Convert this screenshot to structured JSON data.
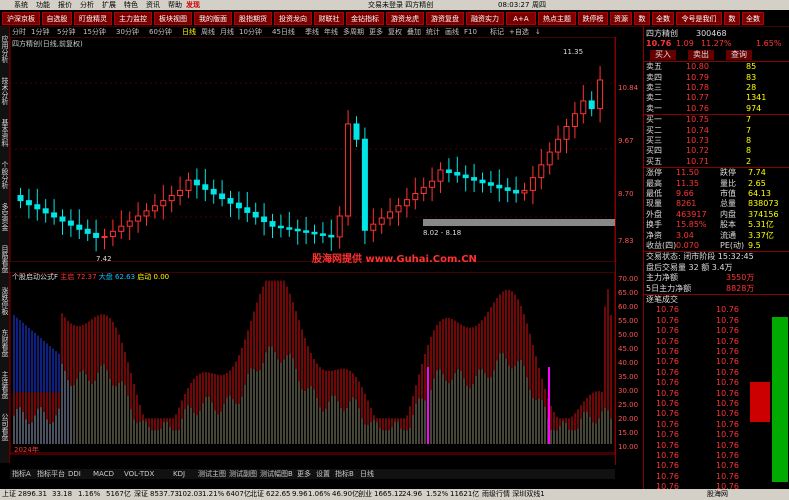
{
  "menu": {
    "items": [
      "系统",
      "功能",
      "报价",
      "分析",
      "扩展",
      "特色",
      "资讯",
      "帮助"
    ],
    "highlight": "发现",
    "center": "交易未登录 四方精创",
    "time": "08:03:27",
    "weekday": "周四"
  },
  "toolbar": [
    "沪深京板",
    "自选股",
    "盯盘精灵",
    "主力监控",
    "板块视图",
    "我的版面",
    "股指期货",
    "投资龙向",
    "财联社",
    "金钻指标",
    "游资龙虎",
    "游资复盘",
    "融资实力",
    "A+A",
    "热点主题",
    "跌停榜",
    "资源",
    "数",
    "全数",
    "令号是我们",
    "数",
    "全数"
  ],
  "period": [
    "分时",
    "1分钟",
    "5分钟",
    "15分钟",
    "30分钟",
    "60分钟",
    "日线",
    "周线",
    "月线",
    "10分钟",
    "45日线",
    "季线",
    "年线",
    "多周期",
    "更多",
    "复权",
    "叠加",
    "统计",
    "画线",
    "F10",
    "标记",
    "+自选",
    "↓"
  ],
  "left_tabs": [
    "应用分析",
    "技术分析",
    "基本资料",
    "个股分析",
    "多空资金",
    "目筋看盘",
    "涨跌停板",
    "东财看盘",
    "主连看盘",
    "公司看盘",
    "分时"
  ],
  "main_header": "四方精创(日线,前复权)",
  "main_ticks": [
    "10.84",
    "9.67",
    "8.70",
    "7.83"
  ],
  "sub_header": {
    "name": "个股启动公式F",
    "a_label": "主启",
    "a_val": "72.37",
    "b_label": "大盘",
    "b_val": "62.63",
    "c_label": "启动",
    "c_val": "0.00"
  },
  "sub_ticks": [
    "70.00",
    "65.00",
    "60.00",
    "55.00",
    "50.00",
    "45.00",
    "40.00",
    "35.00",
    "30.00",
    "25.00",
    "20.00",
    "15.00",
    "10.00"
  ],
  "annotations": {
    "high": "11.35",
    "low": "7.42",
    "range": "8.02 - 8.18",
    "year": "2024年",
    "marker1": "条",
    "marker2": "B1"
  },
  "watermark": "股海网提供 www.Guhai.Com.CN",
  "bottom_tabs": [
    "指标A",
    "指标平台",
    "DDI",
    "MACD",
    "VOL-TDX",
    "KDJ",
    "测试主图",
    "测试副图",
    "测试幅图B",
    "更多",
    "设置",
    "指标B",
    "日线"
  ],
  "stock": {
    "name": "四方精创",
    "code": "300468",
    "price": "10.76",
    "change": "1.09",
    "pct": "11.27%",
    "ratio": "1.65%",
    "btns": [
      "买入",
      "卖出",
      "查询"
    ]
  },
  "asks": [
    {
      "l": "卖五",
      "p": "10.80",
      "v": "85"
    },
    {
      "l": "卖四",
      "p": "10.79",
      "v": "83"
    },
    {
      "l": "卖三",
      "p": "10.78",
      "v": "28"
    },
    {
      "l": "卖二",
      "p": "10.77",
      "v": "1341"
    },
    {
      "l": "卖一",
      "p": "10.76",
      "v": "974"
    }
  ],
  "bids": [
    {
      "l": "买一",
      "p": "10.75",
      "v": "7"
    },
    {
      "l": "买二",
      "p": "10.74",
      "v": "7"
    },
    {
      "l": "买三",
      "p": "10.73",
      "v": "8"
    },
    {
      "l": "买四",
      "p": "10.72",
      "v": "8"
    },
    {
      "l": "买五",
      "p": "10.71",
      "v": "2"
    }
  ],
  "quote": [
    {
      "a": "涨停",
      "b": "11.50",
      "c": "跌停",
      "d": "7.74"
    },
    {
      "a": "最高",
      "b": "11.35",
      "c": "量比",
      "d": "2.65"
    },
    {
      "a": "最低",
      "b": "9.66",
      "c": "市值",
      "d": "64.13"
    },
    {
      "a": "现量",
      "b": "8261",
      "c": "总量",
      "d": "838073"
    },
    {
      "a": "外盘",
      "b": "463917",
      "c": "内盘",
      "d": "374156"
    },
    {
      "a": "换手",
      "b": "15.85%",
      "c": "股本",
      "d": "5.31亿"
    },
    {
      "a": "净资",
      "b": "3.04",
      "c": "流通",
      "d": "3.37亿"
    },
    {
      "a": "收益(四)",
      "b": "0.070",
      "c": "PE(动)",
      "d": "9.5"
    }
  ],
  "trade_status": {
    "line1": "交易状态: 闭市阶段 15:32:45",
    "line2": "盘后交易量 32 额 3.4万"
  },
  "flows": [
    {
      "l": "主力净额",
      "v": "3550万"
    },
    {
      "l": "5日主力净额",
      "v": "8828万"
    }
  ],
  "ticks_title": "逐笔成交",
  "ticks_label": "10.76",
  "status": {
    "sh_label": "上证",
    "sh": "2896.31",
    "sh_chg": "33.18",
    "sh_pct": "1.16%",
    "sh_amt": "5167亿",
    "sz_label": "深证",
    "sz": "8537.73",
    "sz_chg": "102.03",
    "sz_pct": "1.21%",
    "sz_amt": "6407亿",
    "bj_label": "北证",
    "bj": "622.65",
    "bj_chg": "9.96",
    "bj_pct": "1.06%",
    "bj_amt": "46.90亿",
    "cy_label": "创业",
    "cy": "1665.12",
    "cy_chg": "24.96",
    "cy_pct": "1.52%",
    "cy_amt": "11621亿",
    "extra": "雨级行情 深圳双线1",
    "logo": "股海网"
  },
  "colors": {
    "up": "#ff3333",
    "down": "#00e0e0",
    "bg": "#000000",
    "grid": "#800000"
  }
}
